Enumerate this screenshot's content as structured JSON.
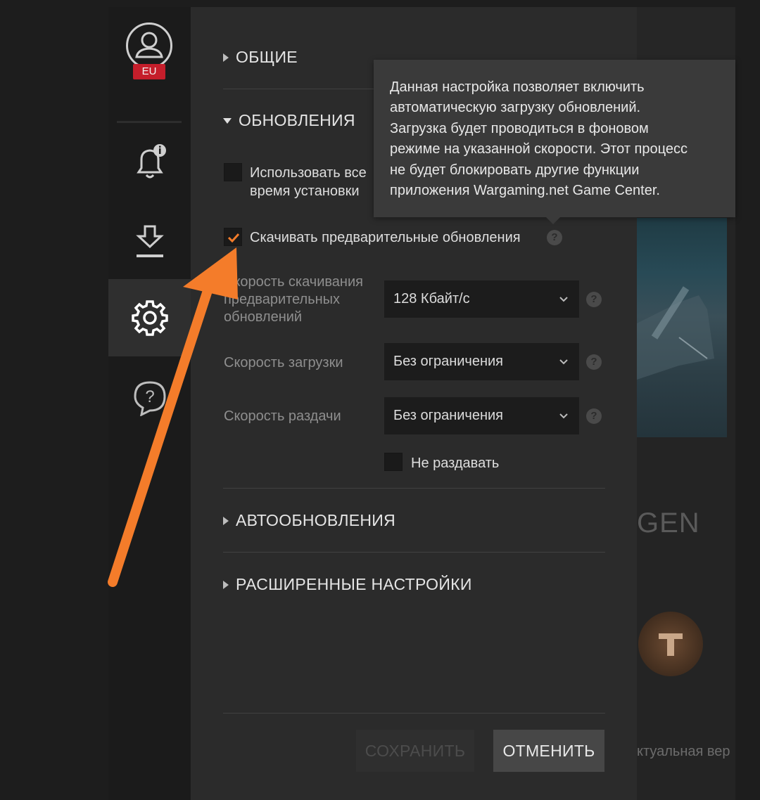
{
  "account": {
    "region": "EU"
  },
  "sections": {
    "general": "ОБЩИЕ",
    "updates": "ОБНОВЛЕНИЯ",
    "auto_updates": "АВТООБНОВЛЕНИЯ",
    "advanced": "РАСШИРЕННЫЕ НАСТРОЙКИ"
  },
  "updates": {
    "use_all_line1": "Использовать все",
    "use_all_line2": "время установки",
    "preload_label": "Скачивать предварительные обновления",
    "preload_speed_label_line1": "Скорость скачивания",
    "preload_speed_label_line2": "предварительных",
    "preload_speed_label_line3": "обновлений",
    "preload_speed_value": "128 Кбайт/с",
    "download_speed_label": "Скорость загрузки",
    "download_speed_value": "Без ограничения",
    "upload_speed_label": "Скорость раздачи",
    "upload_speed_value": "Без ограничения",
    "no_seed_label": "Не раздавать"
  },
  "tooltip": {
    "lines": [
      "Данная настройка позволяет включить",
      "автоматическую загрузку обновлений.",
      "Загрузка будет проводиться в фоновом",
      "режиме на указанной скорости. Этот процесс",
      "не будет блокировать другие функции",
      "приложения Wargaming.net Game Center."
    ]
  },
  "buttons": {
    "save": "СОХРАНИТЬ",
    "cancel": "ОТМЕНИТЬ"
  },
  "background": {
    "game_text": "GEN",
    "footer_text": "ктуальная вер"
  },
  "help_mark": "?",
  "colors": {
    "accent": "#f47c2a",
    "region_badge": "#c51e2b",
    "panel": "#2b2b2b"
  }
}
